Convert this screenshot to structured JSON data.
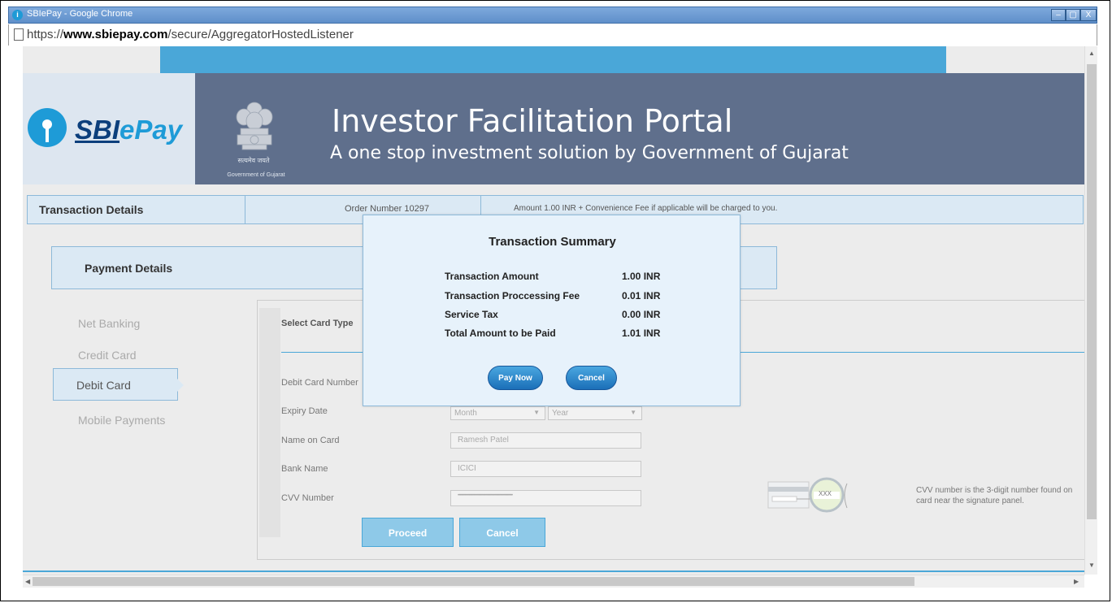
{
  "window": {
    "title": "SBIePay - Google Chrome",
    "minimize": "–",
    "maximize": "▢",
    "close": "X"
  },
  "address_bar": {
    "url_prefix": "https://",
    "url_domain": "www.sbiepay.com",
    "url_path": "/secure/AggregatorHostedListener"
  },
  "banner": {
    "logo_text_dark": "SBI",
    "logo_text_light": "ePay",
    "emblem_caption_1": "सत्यमेव जयते",
    "emblem_caption_2": "Government of Gujarat",
    "title": "Investor Facilitation Portal",
    "subtitle": "A one stop investment solution by Government of Gujarat"
  },
  "transaction_bar": {
    "label": "Transaction Details",
    "order": "Order Number 10297",
    "amount_info": "Amount 1.00 INR + Convenience Fee if applicable will be charged to you."
  },
  "payment": {
    "label": "Payment Details",
    "methods": [
      "Net Banking",
      "Credit Card",
      "Debit Card",
      "Mobile Payments"
    ],
    "selected_method": "Debit Card"
  },
  "form": {
    "card_type_label": "Select Card Type",
    "fields": {
      "card_number_label": "Debit Card Number",
      "expiry_label": "Expiry Date",
      "expiry_month": "Month",
      "expiry_year": "Year",
      "name_label": "Name on Card",
      "name_value": "Ramesh Patel",
      "bank_label": "Bank Name",
      "bank_value": "ICICI",
      "cvv_label": "CVV Number",
      "cvv_value": "•••••••••••••••••••••••••••••••••••••••••••••••••••••••••••••"
    },
    "proceed": "Proceed",
    "cancel": "Cancel",
    "cvv_badge": "XXX",
    "cvv_help": "CVV number is the 3-digit number found on card near the signature panel."
  },
  "modal": {
    "title": "Transaction Summary",
    "rows": [
      {
        "label": "Transaction Amount",
        "value": "1.00 INR"
      },
      {
        "label": "Transaction Proccessing Fee",
        "value": "0.01 INR"
      },
      {
        "label": "Service Tax",
        "value": "0.00 INR"
      },
      {
        "label": "Total Amount to be Paid",
        "value": "1.01 INR"
      }
    ],
    "pay_now": "Pay Now",
    "cancel": "Cancel"
  },
  "colors": {
    "accent_blue": "#4aa7d8",
    "banner_bg": "#5f6f8c",
    "panel_bg": "#dbe9f4",
    "modal_bg": "#e7f2fb"
  }
}
